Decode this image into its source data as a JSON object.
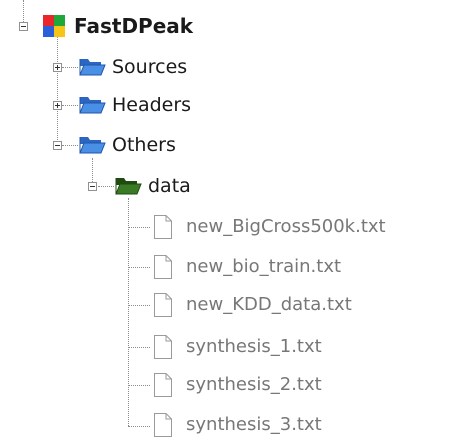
{
  "tree": {
    "root": {
      "label": "FastDPeak",
      "icon": "project-icon",
      "expanded": true
    },
    "children": [
      {
        "label": "Sources",
        "icon": "folder-open-icon",
        "expanded": false
      },
      {
        "label": "Headers",
        "icon": "folder-open-icon",
        "expanded": false
      },
      {
        "label": "Others",
        "icon": "folder-open-icon",
        "expanded": true,
        "children": [
          {
            "label": "data",
            "icon": "folder-open-green-icon",
            "expanded": true,
            "files": [
              "new_BigCross500k.txt",
              "new_bio_train.txt",
              "new_KDD_data.txt",
              "synthesis_1.txt",
              "synthesis_2.txt",
              "synthesis_3.txt"
            ]
          }
        ]
      }
    ]
  },
  "colors": {
    "folder_blue": "#3a7bd5",
    "folder_green": "#2f6b1f",
    "file_text": "#777777",
    "tree_line": "#8c8c8c"
  }
}
